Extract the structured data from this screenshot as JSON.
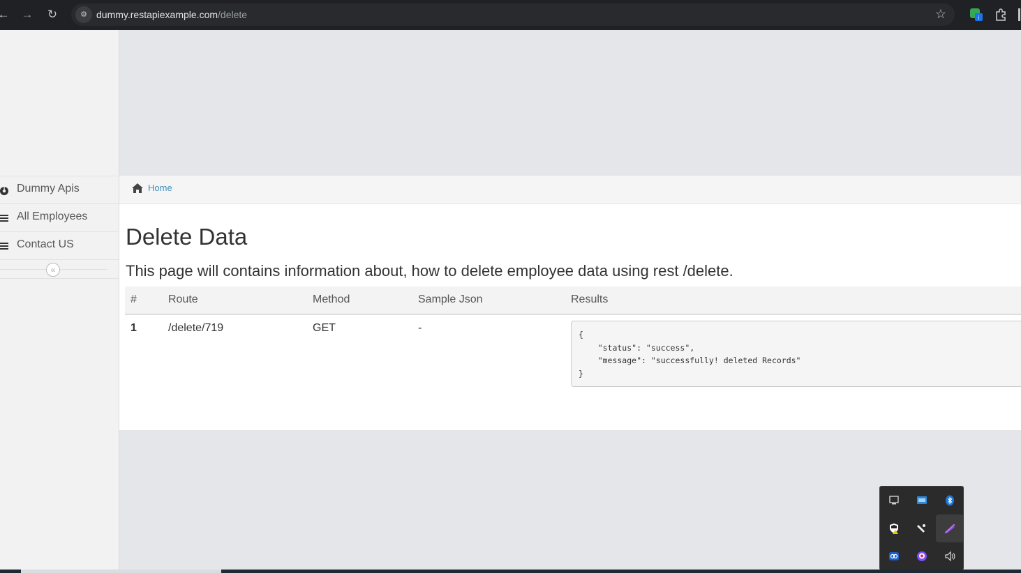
{
  "browser": {
    "url_host": "dummy.restapiexample.com",
    "url_path": "/delete",
    "icons": [
      "back-arrow-icon",
      "forward-arrow-icon",
      "reload-icon",
      "site-info-icon",
      "bookmark-star-icon",
      "extension-badge-icon",
      "puzzle-extensions-icon"
    ]
  },
  "sidebar": {
    "items": [
      {
        "label": "Dummy Apis",
        "icon": "dashboard-icon"
      },
      {
        "label": "All Employees",
        "icon": "list-icon"
      },
      {
        "label": "Contact US",
        "icon": "list-icon"
      }
    ],
    "collapse_icon": "double-chevron-left-icon"
  },
  "breadcrumb": {
    "home_label": "Home",
    "icon": "home-icon"
  },
  "main": {
    "title": "Delete Data",
    "description": "This page will contains information about, how to delete employee data using rest /delete.",
    "table": {
      "headers": [
        "#",
        "Route",
        "Method",
        "Sample Json",
        "Results"
      ],
      "rows": [
        {
          "num": "1",
          "route": "/delete/719",
          "method": "GET",
          "sample_json": "-",
          "result": "{\n    \"status\": \"success\",\n    \"message\": \"successfully! deleted Records\"\n}"
        }
      ]
    }
  },
  "tray": {
    "icons": [
      "display-icon",
      "network-drive-icon",
      "bluetooth-icon",
      "security-warning-icon",
      "pen-tablet-icon",
      "stylus-icon",
      "meet-icon",
      "messenger-icon",
      "volume-icon"
    ]
  },
  "colors": {
    "link": "#438eb9",
    "chrome_bg": "#202124",
    "sidebar_bg": "#f2f2f2",
    "page_bg": "#e5e6e9"
  }
}
